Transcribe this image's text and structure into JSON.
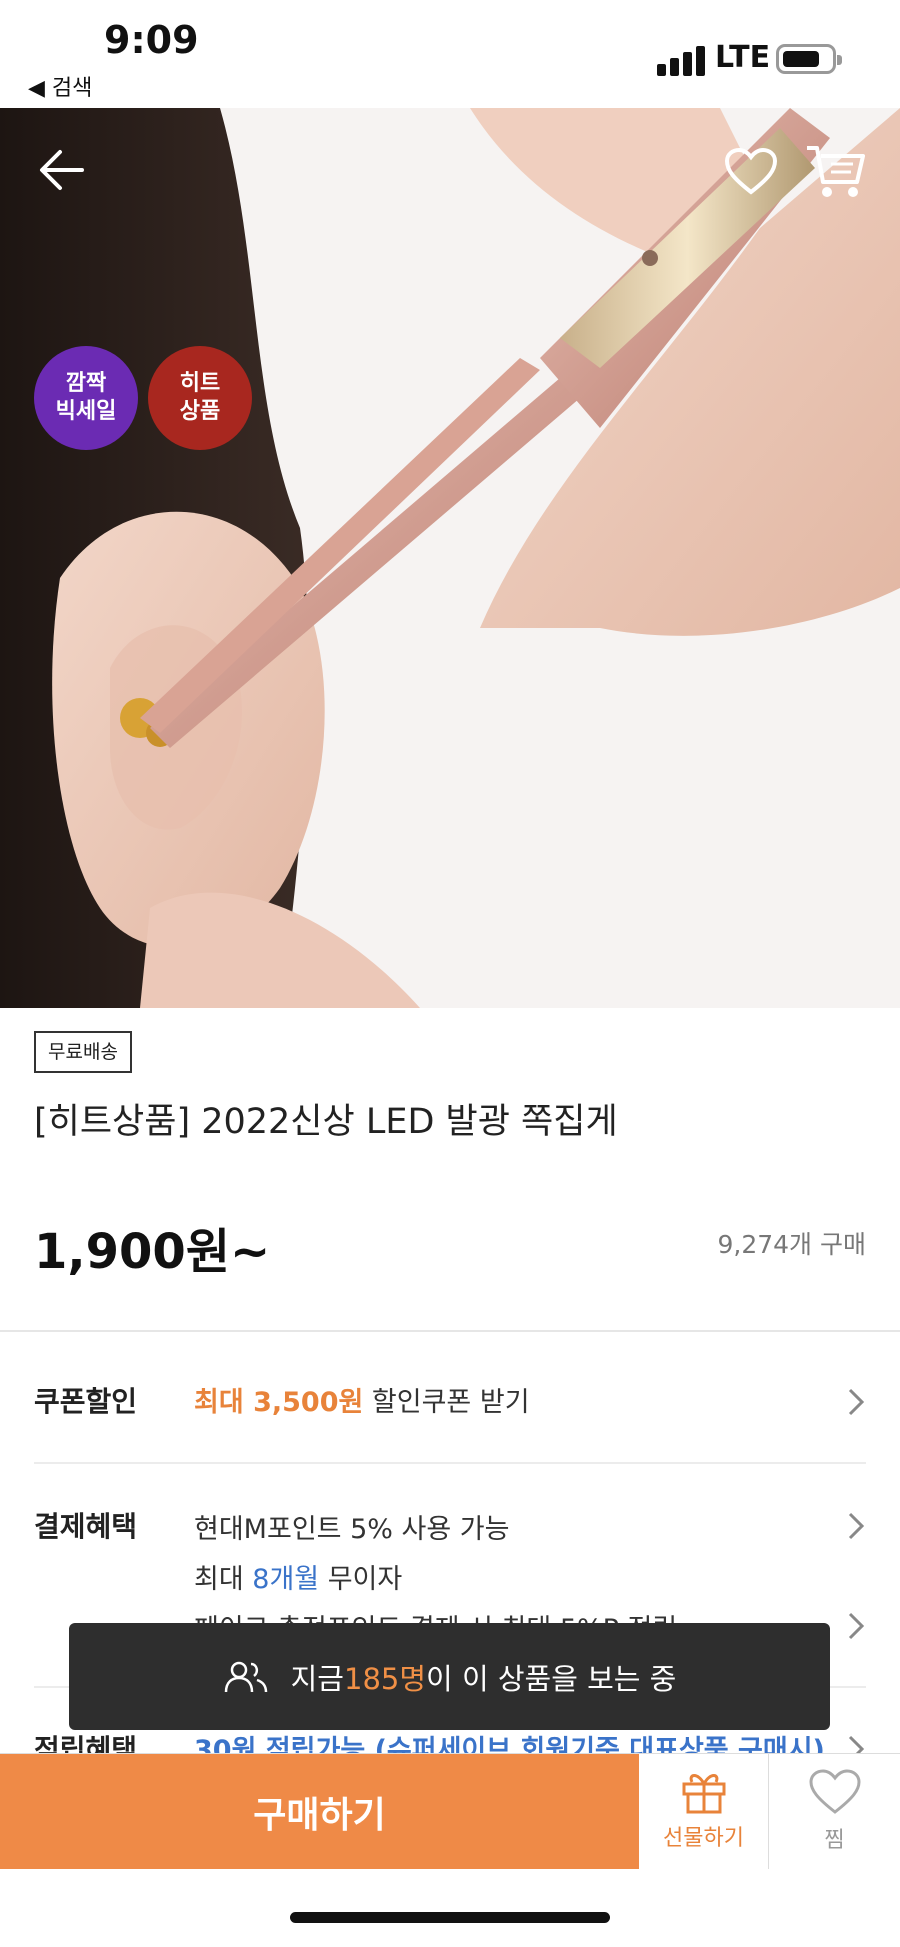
{
  "status_bar": {
    "time": "9:09",
    "back_app": "◀ 검색",
    "network": "LTE"
  },
  "badges": {
    "sale": "깜짝\n빅세일",
    "hit": "히트\n상품"
  },
  "product": {
    "free_shipping": "무료배송",
    "title": "[히트상품] 2022신상 LED 발광 쪽집게",
    "price": "1,900원~",
    "buyers": "9,274개 구매"
  },
  "coupon": {
    "label": "쿠폰할인",
    "highlight": "최대 3,500원",
    "text": " 할인쿠폰 받기"
  },
  "payment": {
    "label": "결제혜택",
    "line1": "현대M포인트 5% 사용 가능",
    "line2_pre": "최대 ",
    "line2_blue": "8개월",
    "line2_post": " 무이자",
    "line3": "페이코 충전포인트 결제 시 최대 5%P 적립"
  },
  "points": {
    "label": "적립혜택",
    "text": "30원 적립가능 (슈퍼세이브 회원기준 대표상품 구매시)"
  },
  "toast": {
    "pre": "지금 ",
    "count": "185명",
    "post": "이 이 상품을 보는 중"
  },
  "bottom_bar": {
    "buy": "구매하기",
    "gift": "선물하기",
    "wish": "찜"
  },
  "colors": {
    "accent": "#ef8a47",
    "sale_badge": "#6b2bb3",
    "hit_badge": "#a8271f",
    "link_blue": "#3a73c9"
  }
}
